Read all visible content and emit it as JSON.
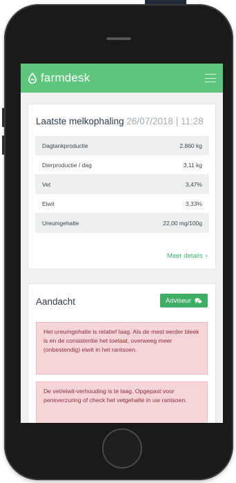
{
  "app": {
    "brand_name": "farmdesk",
    "logo_icon": "drop-icon",
    "menu_icon": "hamburger-icon",
    "header_color": "#5ec67c"
  },
  "milking": {
    "title": "Laatste melkophaling",
    "date": "26/07/2018",
    "separator": "|",
    "time": "11:28",
    "rows": [
      {
        "label": "Dagtankproductie",
        "value": "2.860 kg"
      },
      {
        "label": "Dierproductie / dag",
        "value": "3,11 kg"
      },
      {
        "label": "Vet",
        "value": "3,47%"
      },
      {
        "label": "Eiwit",
        "value": "3,33%"
      },
      {
        "label": "Ureumgehalte",
        "value": "22,00 mg/100g"
      }
    ],
    "details_label": "Meer details",
    "details_icon": "chevron-right-icon"
  },
  "attention": {
    "title": "Aandacht",
    "advisor_label": "Adviseur",
    "advisor_icon": "chat-icon",
    "alerts": [
      {
        "text": "Het ureumgehalte is relatief laag. Als de mest eerder bleek is en de consistentie het toelaat, overweeg meer (onbestendig) eiwit in het rantsoen."
      },
      {
        "text": "De vet/eiwit-verhouding is te laag. Opgepast voor pensverzuring of check het vetgehalte in uw rantsoen."
      }
    ],
    "accent_color": "#3dae63",
    "alert_color": "#f6d5d8"
  }
}
